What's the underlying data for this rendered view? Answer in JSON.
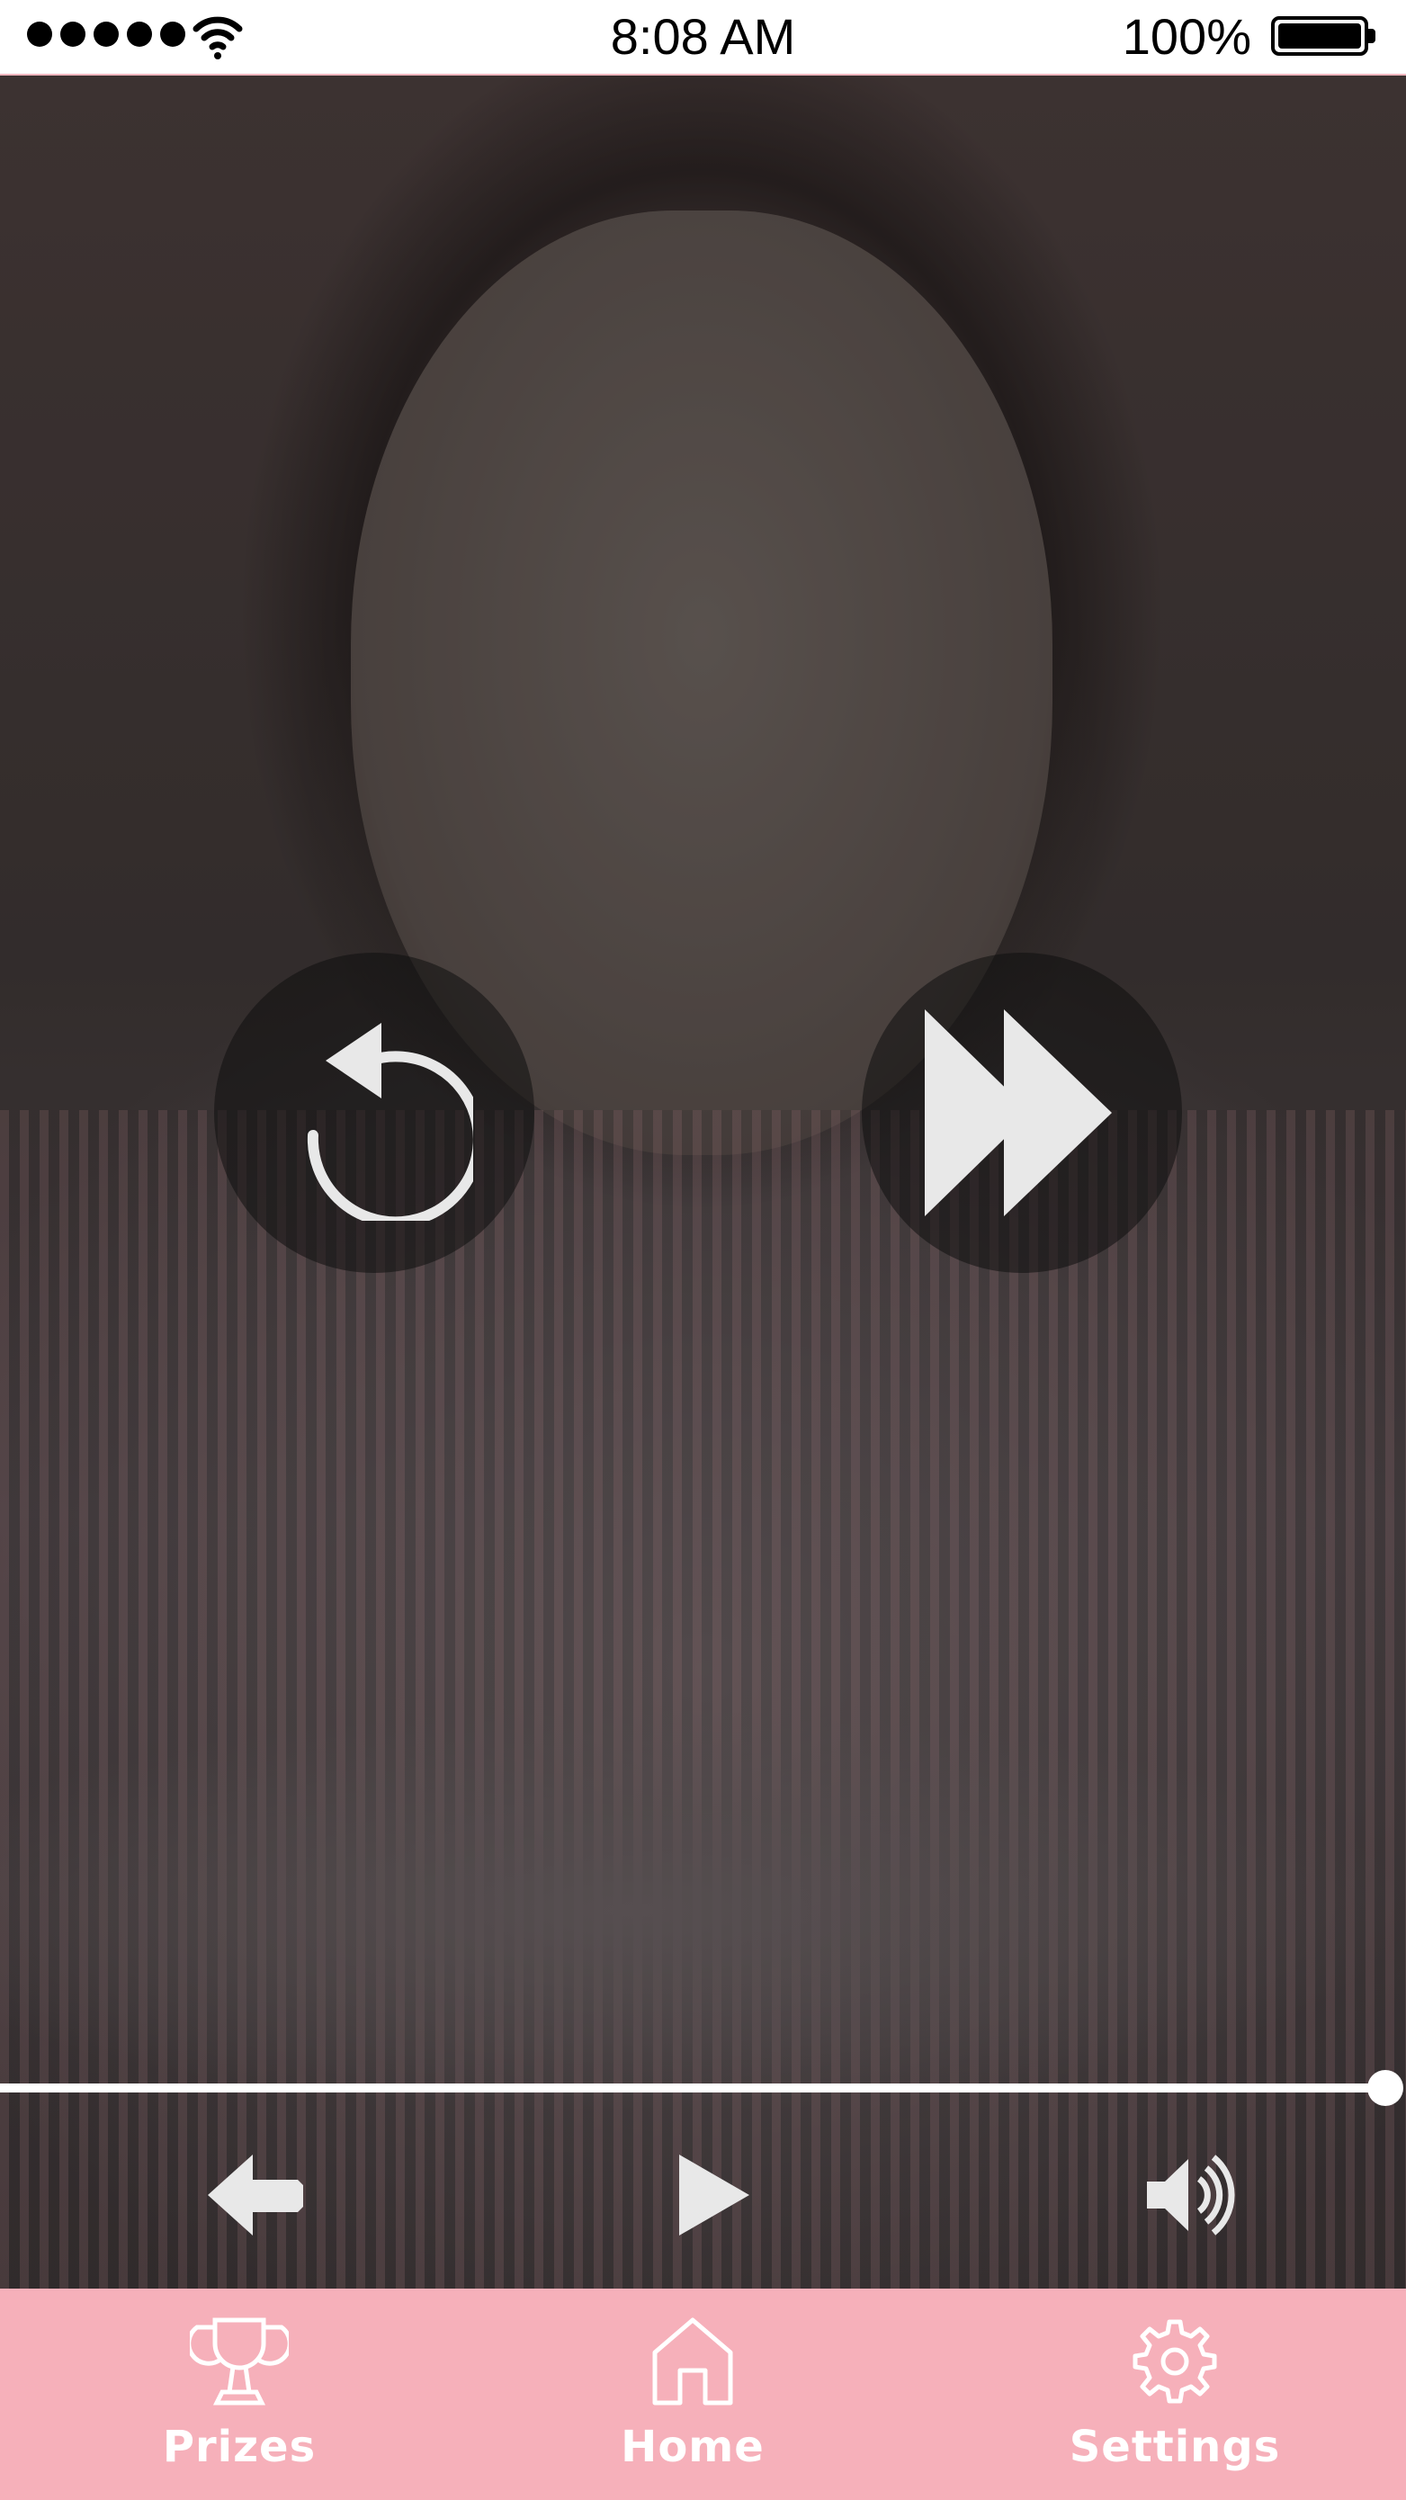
{
  "status_bar": {
    "time": "8:08 AM",
    "battery_percent": "100%",
    "signal_bars": 5,
    "icons": [
      "signal-dots-icon",
      "wifi-icon",
      "battery-icon"
    ]
  },
  "player": {
    "background": "video-frame-girl-frowning",
    "replay_icon": "replay-icon",
    "fast_forward_icon": "fast-forward-icon",
    "progress": 1.0,
    "controls": {
      "back_icon": "back-arrow-icon",
      "play_icon": "play-icon",
      "volume_icon": "volume-icon"
    }
  },
  "tab_bar": {
    "tabs": [
      {
        "label": "Prizes",
        "icon": "trophy-icon"
      },
      {
        "label": "Home",
        "icon": "home-icon"
      },
      {
        "label": "Settings",
        "icon": "gear-icon"
      }
    ]
  },
  "colors": {
    "tab_bar_bg": "#f6b0ba",
    "status_border": "#f1b7bf",
    "icon_fill": "#e8e8e8"
  }
}
